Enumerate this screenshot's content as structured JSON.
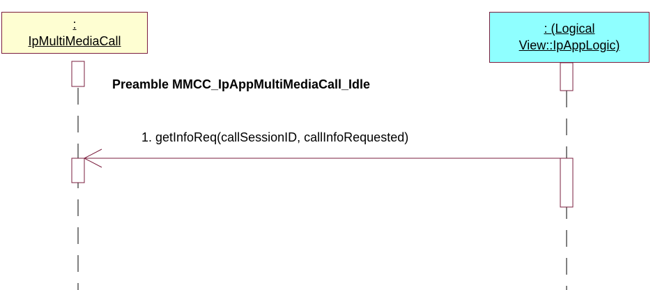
{
  "lifelines": [
    {
      "id": "left",
      "lines": [
        ":",
        "IpMultiMediaCall"
      ],
      "fill": "#fefed2"
    },
    {
      "id": "right",
      "lines": [
        ": (Logical",
        "View::IpAppLogic)"
      ],
      "fill": "#8fffff"
    }
  ],
  "note": "Preamble MMCC_IpAppMultiMediaCall_Idle",
  "messages": [
    {
      "label": "1. getInfoReq(callSessionID, callInfoRequested)",
      "from": "right",
      "to": "left"
    }
  ],
  "colors": {
    "border": "#7a1c3c",
    "lifeline": "#000000"
  }
}
